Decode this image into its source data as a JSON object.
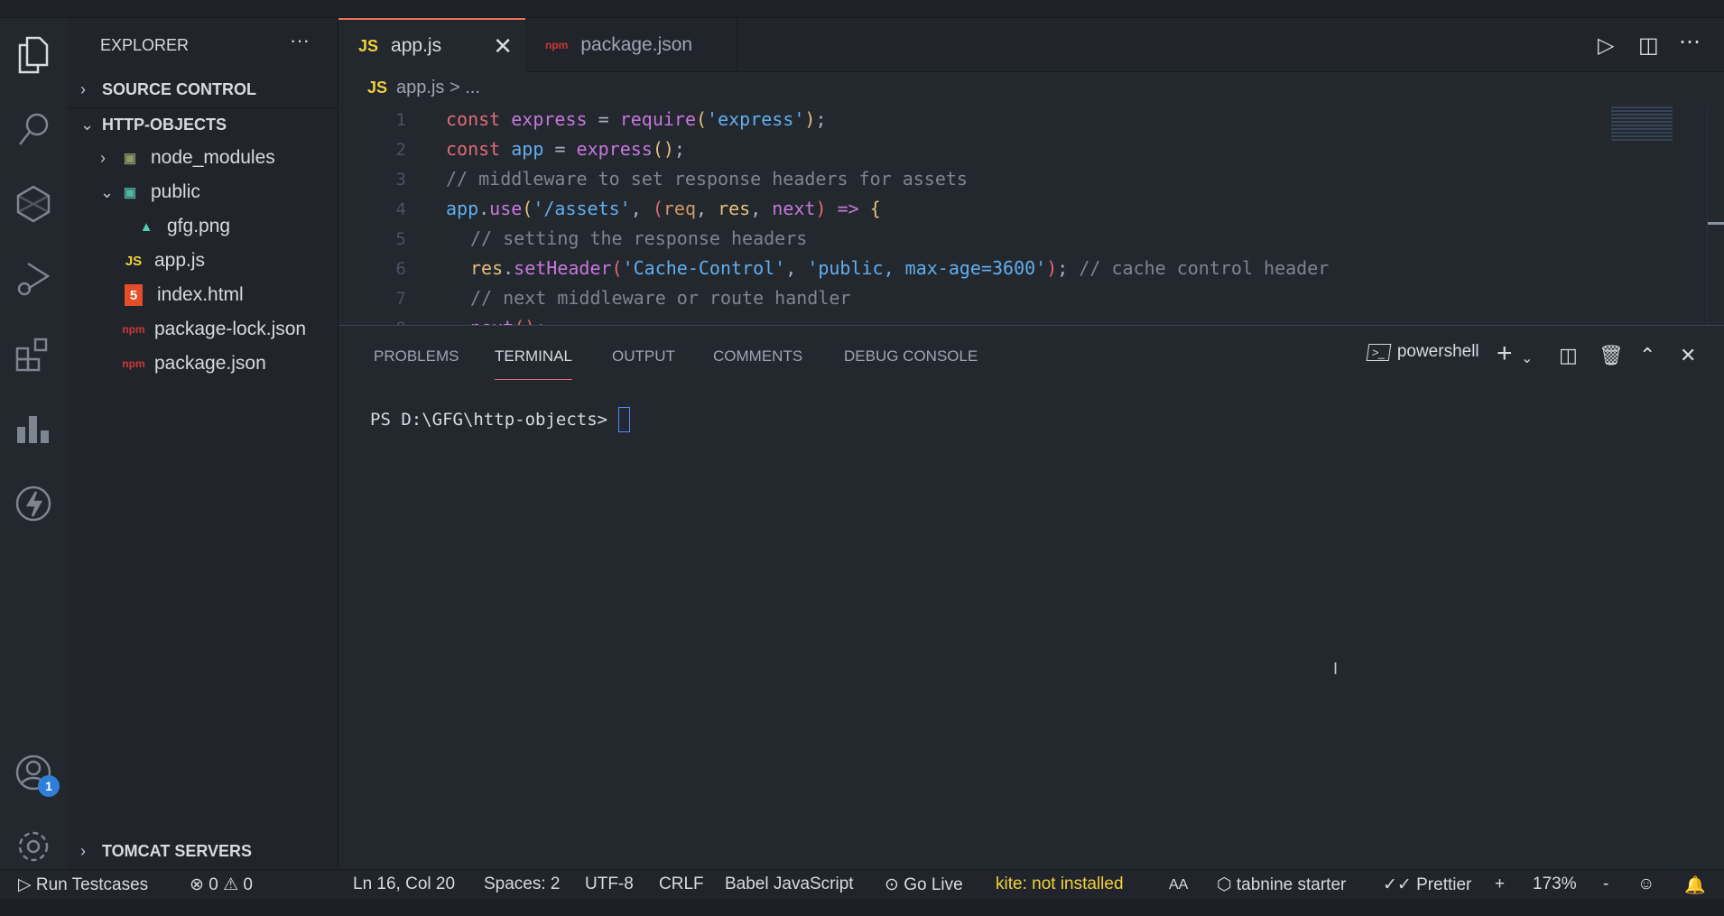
{
  "window": {
    "title": "app.js - http-objects - Visual Studio Code"
  },
  "sidebar": {
    "title": "EXPLORER",
    "more": "···",
    "sections": {
      "source_control": "SOURCE CONTROL",
      "project": "HTTP-OBJECTS",
      "tomcat": "TOMCAT SERVERS"
    },
    "tree": [
      {
        "label": "node_modules",
        "type": "folder"
      },
      {
        "label": "public",
        "type": "folder-open"
      },
      {
        "label": "gfg.png",
        "type": "image"
      },
      {
        "label": "app.js",
        "type": "js"
      },
      {
        "label": "index.html",
        "type": "html"
      },
      {
        "label": "package-lock.json",
        "type": "npm"
      },
      {
        "label": "package.json",
        "type": "npm"
      }
    ]
  },
  "tabs": [
    {
      "label": "app.js",
      "icon": "JS",
      "active": true
    },
    {
      "label": "package.json",
      "icon": "npm",
      "active": false
    }
  ],
  "breadcrumb": {
    "icon": "JS",
    "file": "app.js",
    "sep": ">",
    "rest": "..."
  },
  "editor": {
    "line_numbers": [
      "1",
      "2",
      "3",
      "4",
      "5",
      "6",
      "7",
      "8"
    ]
  },
  "panel": {
    "tabs": [
      "PROBLEMS",
      "TERMINAL",
      "OUTPUT",
      "COMMENTS",
      "DEBUG CONSOLE"
    ],
    "active": "TERMINAL",
    "shell": "powershell",
    "prompt": "PS D:\\GFG\\http-objects> "
  },
  "activity": {
    "badge": "1"
  },
  "status": {
    "run": "Run Testcases",
    "errors": "0",
    "warnings": "0",
    "position": "Ln 16, Col 20",
    "spaces": "Spaces: 2",
    "encoding": "UTF-8",
    "eol": "CRLF",
    "language": "Babel JavaScript",
    "golive": "Go Live",
    "kite": "kite: not installed",
    "aa": "AA",
    "tabnine": "tabnine starter",
    "prettier": "Prettier",
    "plus": "+",
    "zoom": "173%",
    "minus": "-"
  }
}
